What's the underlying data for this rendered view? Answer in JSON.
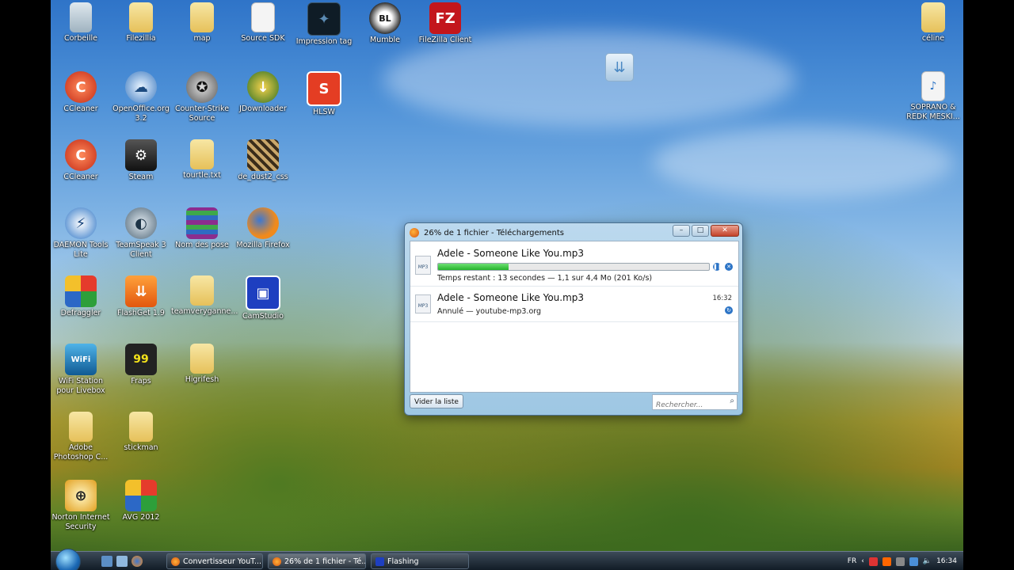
{
  "desktop": {
    "icons": [
      {
        "label": "Corbeille",
        "kind": "trash"
      },
      {
        "label": "Filezillia",
        "kind": "folder"
      },
      {
        "label": "map",
        "kind": "folder"
      },
      {
        "label": "Source SDK",
        "kind": "doc"
      },
      {
        "label": "Impression tag",
        "kind": "app"
      },
      {
        "label": "Mumble",
        "kind": "app"
      },
      {
        "label": "FileZilla Client",
        "kind": "app"
      },
      {
        "label": "céline",
        "kind": "folder"
      },
      {
        "label": "CCleaner",
        "kind": "app"
      },
      {
        "label": "OpenOffice.org 3.2",
        "kind": "app"
      },
      {
        "label": "Counter-Strike Source",
        "kind": "app"
      },
      {
        "label": "JDownloader",
        "kind": "app"
      },
      {
        "label": "HLSW",
        "kind": "app"
      },
      {
        "label": "SOPRANO & REDK MESKI...",
        "kind": "mp3"
      },
      {
        "label": "CCleaner",
        "kind": "app"
      },
      {
        "label": "Steam",
        "kind": "app"
      },
      {
        "label": "tourtle.txt",
        "kind": "folder"
      },
      {
        "label": "de_dust2_css",
        "kind": "app"
      },
      {
        "label": "DAEMON Tools Lite",
        "kind": "app"
      },
      {
        "label": "TeamSpeak 3 Client",
        "kind": "app"
      },
      {
        "label": "Nom des pose",
        "kind": "app"
      },
      {
        "label": "Mozilla Firefox",
        "kind": "app"
      },
      {
        "label": "Defraggler",
        "kind": "app"
      },
      {
        "label": "FlashGet 1.9",
        "kind": "app"
      },
      {
        "label": "teamveryganne...",
        "kind": "folder"
      },
      {
        "label": "CamStudio",
        "kind": "app"
      },
      {
        "label": "WiFi Station pour Livebox",
        "kind": "app"
      },
      {
        "label": "Fraps",
        "kind": "app"
      },
      {
        "label": "Higrifesh",
        "kind": "folder"
      },
      {
        "label": "Adobe Photoshop C...",
        "kind": "folder"
      },
      {
        "label": "stickman",
        "kind": "folder"
      },
      {
        "label": "Norton Internet Security",
        "kind": "app"
      },
      {
        "label": "AVG 2012",
        "kind": "app"
      }
    ]
  },
  "download_window": {
    "title": "26% de 1 fichier - Téléchargements",
    "minimize_icon": "minimize-icon",
    "maximize_icon": "maximize-icon",
    "close_icon": "close-icon",
    "items": [
      {
        "filename": "Adele - Someone Like You.mp3",
        "status": "Temps restant : 13 secondes — 1,1 sur 4,4 Mo (201 Ko/s)",
        "progress_percent": 26,
        "file_icon_text": "MP3"
      },
      {
        "filename": "Adele - Someone Like You.mp3",
        "status": "Annulé — youtube-mp3.org",
        "time": "16:32",
        "file_icon_text": "MP3"
      }
    ],
    "clear_button": "Vider la liste",
    "search_placeholder": "Rechercher..."
  },
  "taskbar": {
    "tasks": [
      {
        "label": "Convertisseur YouT..."
      },
      {
        "label": "26% de 1 fichier - Té..."
      },
      {
        "label": "Flashing"
      }
    ],
    "tray": {
      "language": "FR",
      "clock": "16:34"
    }
  }
}
